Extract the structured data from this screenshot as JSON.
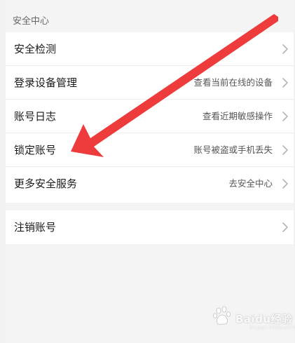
{
  "section_header": "安全中心",
  "security_rows": [
    {
      "title": "安全检测",
      "hint": ""
    },
    {
      "title": "登录设备管理",
      "hint": "查看当前在线的设备"
    },
    {
      "title": "账号日志",
      "hint": "查看近期敏感操作"
    },
    {
      "title": "锁定账号",
      "hint": "账号被盗或手机丢失"
    },
    {
      "title": "更多安全服务",
      "hint": "去安全中心"
    }
  ],
  "cancel_row": {
    "title": "注销账号"
  },
  "watermark": {
    "text": "Baidu经验",
    "sub": "jingyan.baidu.com"
  },
  "colors": {
    "background": "#f4f4f4",
    "card": "#ffffff",
    "divider": "#ececec",
    "arrow": "#ee3b3b",
    "chevron": "#b5b5b5"
  },
  "icons": {
    "row_chevron": "chevron-right-icon",
    "annotation": "red-arrow-icon",
    "watermark_logo": "baidu-paw-icon"
  }
}
